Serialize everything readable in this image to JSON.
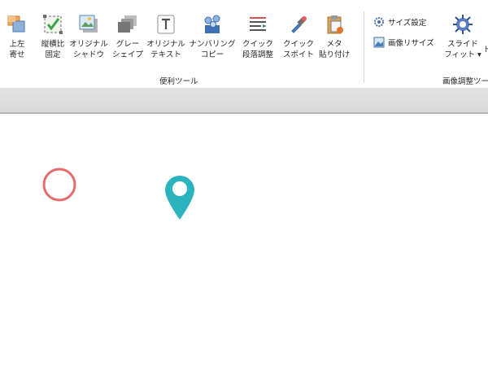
{
  "ribbon": {
    "tools": [
      {
        "name": "top-left-align-button",
        "icon": "top-left-align-icon",
        "line1": "上左",
        "line2": "寄せ"
      },
      {
        "name": "aspect-lock-button",
        "icon": "aspect-lock-icon",
        "line1": "縦横比",
        "line2": "固定"
      },
      {
        "name": "original-shadow-button",
        "icon": "shadow-image-icon",
        "line1": "オリジナル",
        "line2": "シャドウ"
      },
      {
        "name": "gray-shape-button",
        "icon": "gray-shape-icon",
        "line1": "グレー",
        "line2": "シェイプ"
      },
      {
        "name": "original-text-button",
        "icon": "text-box-icon",
        "line1": "オリジナル",
        "line2": "テキスト"
      },
      {
        "name": "numbering-copy-button",
        "icon": "numbering-copy-icon",
        "line1": "ナンバリング",
        "line2": "コピー"
      },
      {
        "name": "quick-paragraph-button",
        "icon": "paragraph-adjust-icon",
        "line1": "クイック",
        "line2": "段落調整"
      },
      {
        "name": "quick-eyedropper-button",
        "icon": "eyedropper-icon",
        "line1": "クイック",
        "line2": "スポイト"
      },
      {
        "name": "meta-paste-button",
        "icon": "meta-paste-icon",
        "line1": "メタ",
        "line2": "貼り付け"
      }
    ],
    "group_convenience": "便利ツール",
    "size_setting": "サイズ設定",
    "image_resize": "画像リサイズ",
    "slide_fit": {
      "line1": "スライド",
      "line2": "フィット ▾",
      "icon": "slide-fit-icon"
    },
    "partial_tool": "ト",
    "group_image": "画像調整ツール"
  },
  "colors": {
    "circle": "#e86b6b",
    "pin": "#2bb3c0"
  }
}
